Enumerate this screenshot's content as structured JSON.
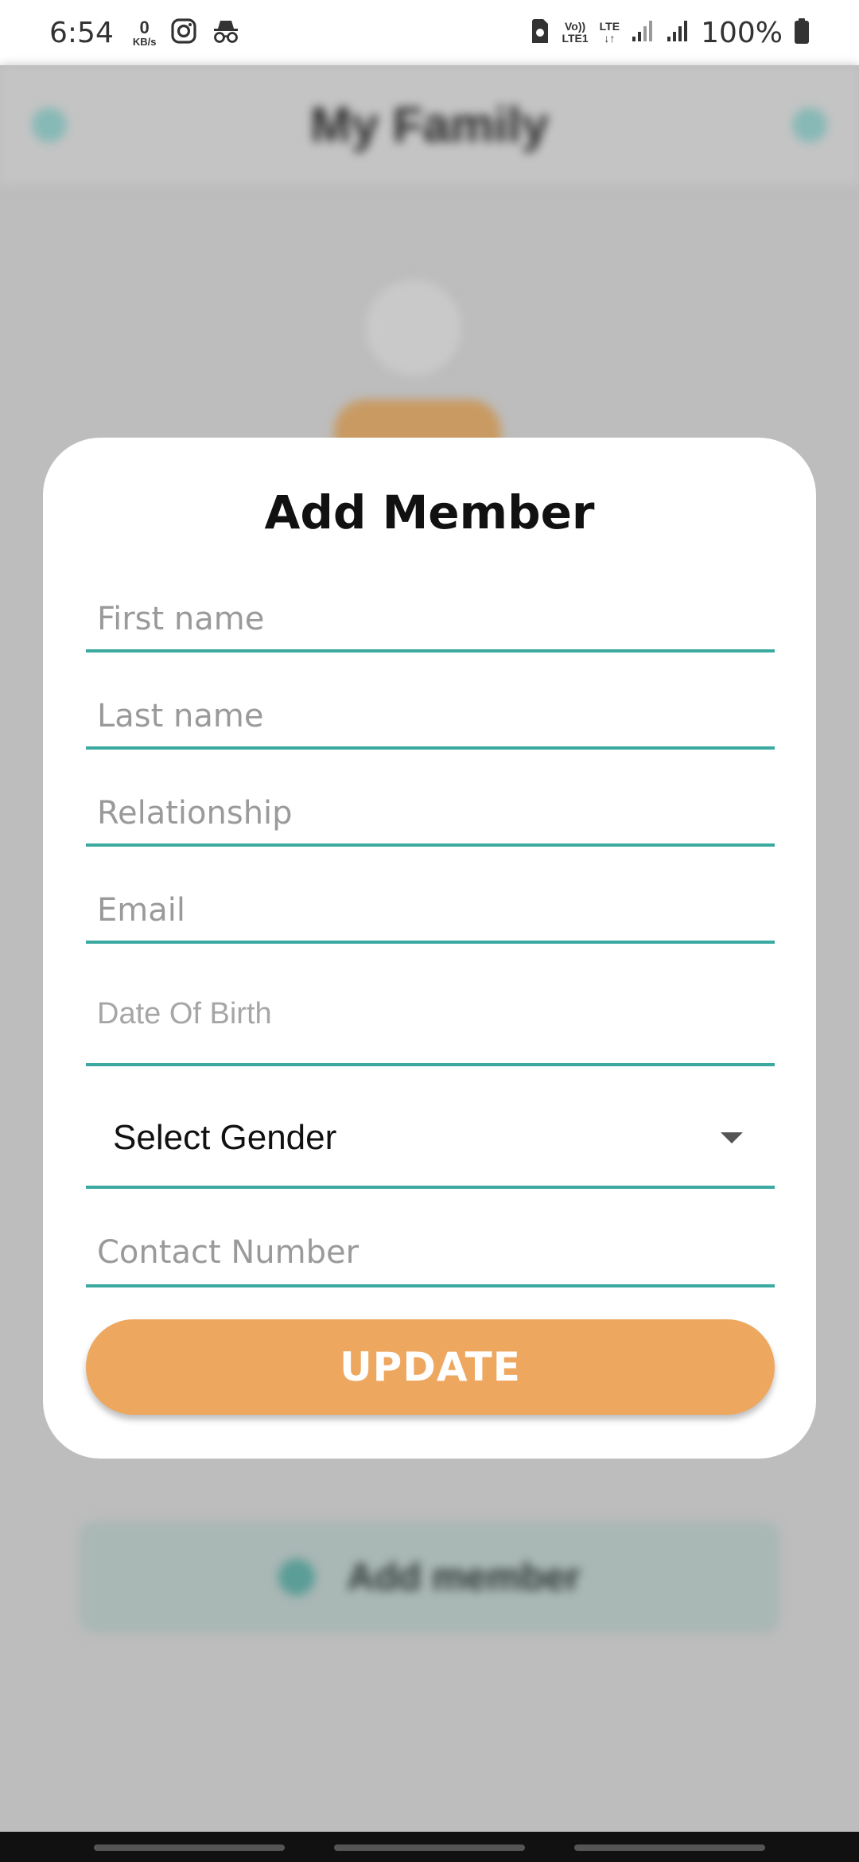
{
  "status_bar": {
    "time": "6:54",
    "kbs_value": "0",
    "kbs_unit": "KB/s",
    "volte_label": "Vo))",
    "lte1_label": "LTE1",
    "lte_label": "LTE",
    "battery_percent": "100%",
    "icons": [
      "instagram-icon",
      "incognito-icon",
      "sim-icon",
      "signal-icon",
      "signal-icon",
      "battery-icon"
    ]
  },
  "background_app": {
    "title": "My Family",
    "add_label": "Add member"
  },
  "modal": {
    "title": "Add Member",
    "fields": {
      "first_name_placeholder": "First name",
      "last_name_placeholder": "Last name",
      "relationship_placeholder": "Relationship",
      "email_placeholder": "Email",
      "dob_placeholder": "Date Of Birth",
      "gender_select_value": "Select Gender",
      "contact_placeholder": "Contact Number"
    },
    "update_button_label": "UPDATE"
  },
  "colors": {
    "accent_teal": "#3ca9a1",
    "button_orange": "#eea75f",
    "overlay_gray": "#bdbdbd"
  }
}
